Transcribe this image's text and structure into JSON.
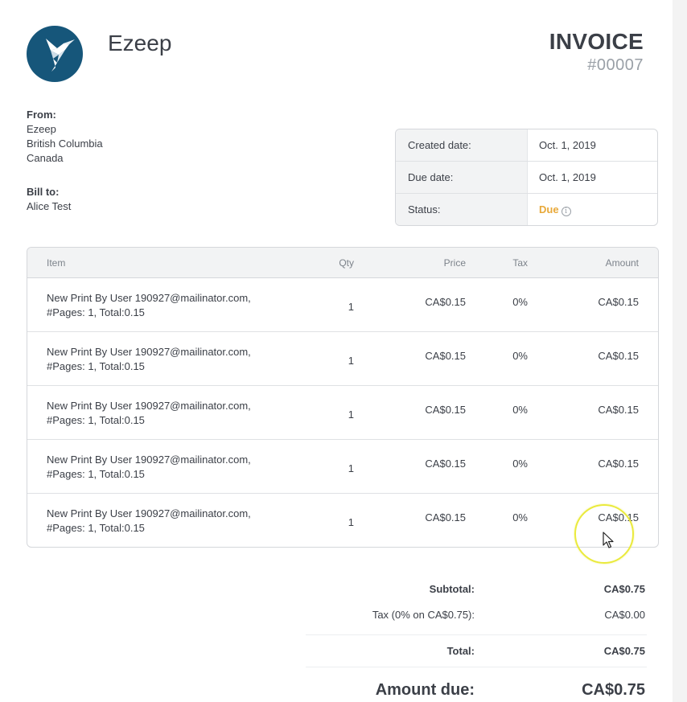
{
  "company": {
    "name": "Ezeep"
  },
  "invoice": {
    "title": "INVOICE",
    "number": "#00007"
  },
  "from": {
    "label": "From:",
    "lines": [
      "Ezeep",
      "British Columbia",
      "Canada"
    ]
  },
  "bill_to": {
    "label": "Bill to:",
    "name": "Alice Test"
  },
  "meta": {
    "created_label": "Created date:",
    "created_value": "Oct. 1, 2019",
    "due_label": "Due date:",
    "due_value": "Oct. 1, 2019",
    "status_label": "Status:",
    "status_value": "Due",
    "status_color": "#e8a93a"
  },
  "table": {
    "headers": {
      "item": "Item",
      "qty": "Qty",
      "price": "Price",
      "tax": "Tax",
      "amount": "Amount"
    },
    "rows": [
      {
        "line1": "New Print By User 190927@mailinator.com,",
        "line2": "#Pages: 1, Total:0.15",
        "qty": "1",
        "price": "CA$0.15",
        "tax": "0%",
        "amount": "CA$0.15"
      },
      {
        "line1": "New Print By User 190927@mailinator.com,",
        "line2": "#Pages: 1, Total:0.15",
        "qty": "1",
        "price": "CA$0.15",
        "tax": "0%",
        "amount": "CA$0.15"
      },
      {
        "line1": "New Print By User 190927@mailinator.com,",
        "line2": "#Pages: 1, Total:0.15",
        "qty": "1",
        "price": "CA$0.15",
        "tax": "0%",
        "amount": "CA$0.15"
      },
      {
        "line1": "New Print By User 190927@mailinator.com,",
        "line2": "#Pages: 1, Total:0.15",
        "qty": "1",
        "price": "CA$0.15",
        "tax": "0%",
        "amount": "CA$0.15"
      },
      {
        "line1": "New Print By User 190927@mailinator.com,",
        "line2": "#Pages: 1, Total:0.15",
        "qty": "1",
        "price": "CA$0.15",
        "tax": "0%",
        "amount": "CA$0.15"
      }
    ]
  },
  "totals": {
    "subtotal_label": "Subtotal:",
    "subtotal_value": "CA$0.75",
    "tax_label": "Tax (0% on CA$0.75):",
    "tax_value": "CA$0.00",
    "total_label": "Total:",
    "total_value": "CA$0.75",
    "amount_due_label": "Amount due:",
    "amount_due_value": "CA$0.75"
  },
  "colors": {
    "brand": "#16567a",
    "status_due": "#e8a93a",
    "cursor_highlight": "#eaea3c"
  },
  "icons": {
    "logo": "hummingbird-logo",
    "status_info": "info-icon",
    "pointer": "mouse-cursor-icon"
  }
}
